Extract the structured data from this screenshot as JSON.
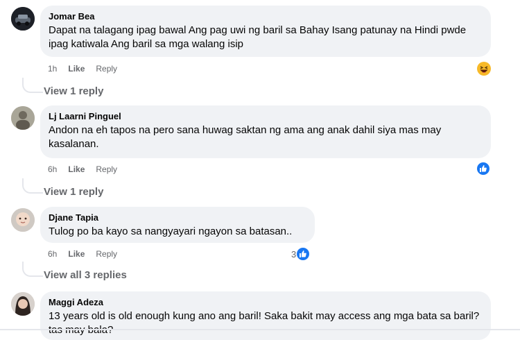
{
  "comments": [
    {
      "name": "Jomar Bea",
      "text": "Dapat na talagang ipag bawal Ang pag uwi ng baril sa Bahay Isang patunay na Hindi pwde ipag katiwala Ang baril sa mga walang isip",
      "time": "1h",
      "like_label": "Like",
      "reply_label": "Reply",
      "reaction": "haha-icon",
      "replies_link": "View 1 reply"
    },
    {
      "name": "Lj Laarni Pinguel",
      "text": "Andon na eh tapos na pero sana huwag saktan ng ama ang anak dahil siya mas may kasalanan.",
      "time": "6h",
      "like_label": "Like",
      "reply_label": "Reply",
      "reaction": "like-icon",
      "replies_link": "View 1 reply"
    },
    {
      "name": "Djane Tapia",
      "text": "Tulog po ba kayo sa nangyayari ngayon sa batasan..",
      "time": "6h",
      "like_label": "Like",
      "reply_label": "Reply",
      "reaction": "like-icon",
      "reaction_count": "3",
      "replies_link": "View all 3 replies"
    },
    {
      "name": "Maggi Adeza",
      "text": "13 years old is old enough kung ano ang baril! Saka bakit may access ang mga bata sa baril? tas may bala?"
    }
  ],
  "colors": {
    "bubble": "#f0f2f5",
    "meta": "#65676b",
    "like_blue": "#1877f2",
    "haha_yellow": "#f7b928"
  }
}
